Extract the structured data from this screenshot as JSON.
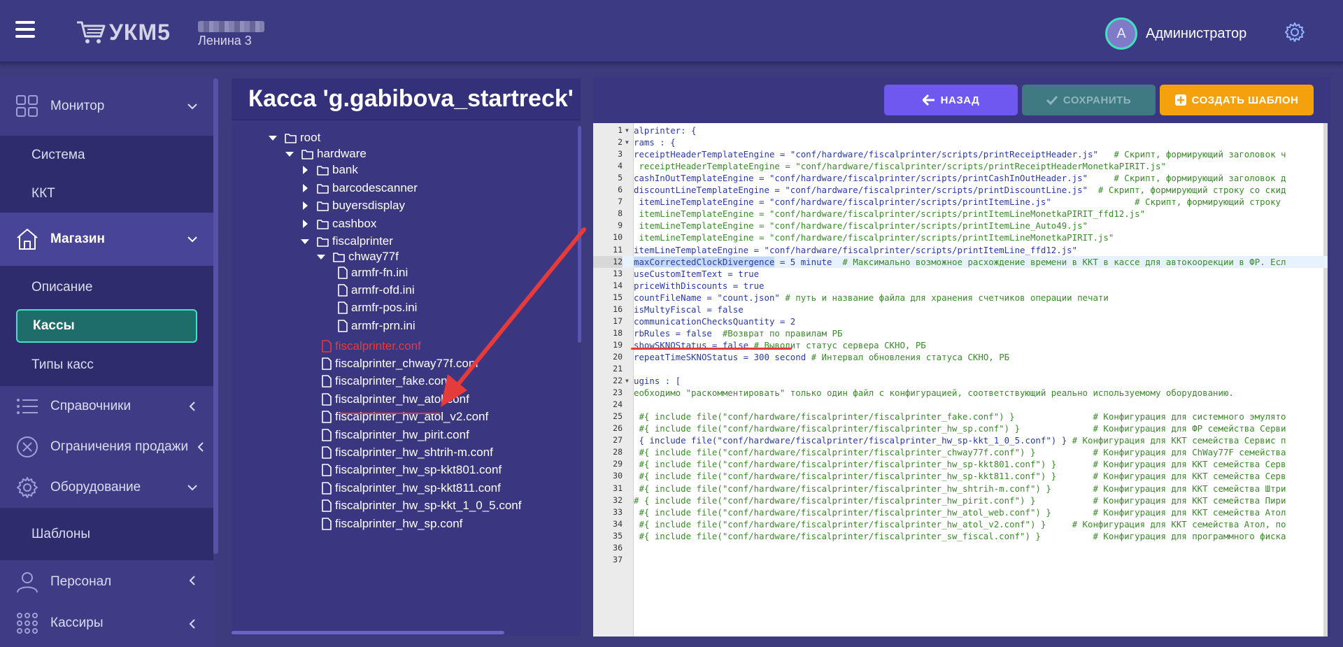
{
  "header": {
    "logo_text": "УКМ5",
    "store_name": "Ленина 3",
    "avatar_letter": "А",
    "user_name": "Администратор"
  },
  "sidebar": {
    "monitor": "Монитор",
    "monitor_items": [
      "Система",
      "ККТ"
    ],
    "shop": "Магазин",
    "shop_items": [
      "Описание",
      "Кассы",
      "Типы касс"
    ],
    "references": "Справочники",
    "restrictions": "Ограничения продажи",
    "equipment": "Оборудование",
    "equipment_items": [
      "Шаблоны"
    ],
    "staff": "Персонал",
    "cashiers": "Кассиры"
  },
  "tree": {
    "title": "Касса 'g.gabibova_startreck'",
    "nodes": [
      "root",
      "hardware",
      "bank",
      "barcodescanner",
      "buyersdisplay",
      "cashbox",
      "fiscalprinter",
      "chway77f",
      "armfr-fn.ini",
      "armfr-ofd.ini",
      "armfr-pos.ini",
      "armfr-prn.ini",
      "fiscalprinter.conf",
      "fiscalprinter_chway77f.conf",
      "fiscalprinter_fake.conf",
      "fiscalprinter_hw_atol.conf",
      "fiscalprinter_hw_atol_v2.conf",
      "fiscalprinter_hw_pirit.conf",
      "fiscalprinter_hw_shtrih-m.conf",
      "fiscalprinter_hw_sp-kkt801.conf",
      "fiscalprinter_hw_sp-kkt811.conf",
      "fiscalprinter_hw_sp-kkt_1_0_5.conf",
      "fiscalprinter_hw_sp.conf"
    ]
  },
  "toolbar": {
    "back_label": "НАЗАД",
    "save_label": "СОХРАНИТЬ",
    "create_label": "СОЗДАТЬ ШАБЛОН"
  },
  "editor": {
    "lines": [
      "alprinter: {",
      "rams : {",
      "receiptHeaderTemplateEngine = \"conf/hardware/fiscalprinter/scripts/printReceiptHeader.js\"   # Скрипт, формирующий заголовок ч",
      " receiptHeaderTemplateEngine = \"conf/hardware/fiscalprinter/scripts/printReceiptHeaderMonetkaPIRIT.js\"",
      "cashInOutTemplateEngine = \"conf/hardware/fiscalprinter/scripts/printCashInOutHeader.js\"     # Скрипт, формирующий заголовок д",
      "discountLineTemplateEngine = \"conf/hardware/fiscalprinter/scripts/printDiscountLine.js\"  # Скрипт, формирующий строку со скид",
      " itemLineTemplateEngine = \"conf/hardware/fiscalprinter/scripts/printItemLine.js\"                # Скрипт, формирующий строку",
      " itemLineTemplateEngine = \"conf/hardware/fiscalprinter/scripts/printItemLineMonetkaPIRIT_ffd12.js\"",
      " itemLineTemplateEngine = \"conf/hardware/fiscalprinter/scripts/printItemLine_Auto49.js\"",
      " itemLineTemplateEngine = \"conf/hardware/fiscalprinter/scripts/printItemLineMonetkaPIRIT.js\"",
      "itemLineTemplateEngine = \"conf/hardware/fiscalprinter/scripts/printItemLine_ffd12.js\"",
      "maxCorrectedClockDivergence = 5 minute  # Максимально возможное расхождение времени в ККТ в кассе для автокоорекции в ФР. Есл",
      "useCustomItemText = true",
      "priceWithDiscounts = true",
      "countFileName = \"count.json\" # путь и название файла для хранения счетчиков операции печати",
      "isMultyFiscal = false",
      "communicationChecksQuantity = 2",
      "rbRules = false  #Возврат по правилам РБ",
      "showSKNOStatus = false # Выводит статус сервера СКНО, РБ",
      "repeatTimeSKNOStatus = 300 second # Интервал обновления статуса СКНО, РБ",
      "",
      "ugins : [",
      "еобходимо \"раскомментировать\" только один файл с конфигурацией, соответствующий реально используемому оборудованию.",
      "",
      " #{ include file(\"conf/hardware/fiscalprinter/fiscalprinter_fake.conf\") }               # Конфигурация для системного эмулято",
      " #{ include file(\"conf/hardware/fiscalprinter/fiscalprinter_hw_sp.conf\") }              # Конфигурация для ФР семейства Серви",
      " { include file(\"conf/hardware/fiscalprinter/fiscalprinter_hw_sp-kkt_1_0_5.conf\") } # Конфигурация для ККТ семейства Сервис п",
      " #{ include file(\"conf/hardware/fiscalprinter/fiscalprinter_chway77f.conf\") }           # Конфигурация для ChWay77F семейства",
      " #{ include file(\"conf/hardware/fiscalprinter/fiscalprinter_hw_sp-kkt801.conf\") }       # Конфигурация для ККТ семейства Серв",
      " #{ include file(\"conf/hardware/fiscalprinter/fiscalprinter_hw_sp-kkt811.conf\") }       # Конфигурация для ККТ семейства Серв",
      " #{ include file(\"conf/hardware/fiscalprinter/fiscalprinter_hw_shtrih-m.conf\") }        # Конфигурация для ККТ семейства Штри",
      "# { include file(\"conf/hardware/fiscalprinter/fiscalprinter_hw_pirit.conf\") }           # Конфигурация для ККТ семейства Пири",
      " #{ include file(\"conf/hardware/fiscalprinter/fiscalprinter_hw_atol_web.conf\") }        # Конфигурация для ККТ семейства Атол",
      " #{ include file(\"conf/hardware/fiscalprinter/fiscalprinter_hw_atol_v2.conf\") }     # Конфигурация для ККТ семейства Атол, по",
      " #{ include file(\"conf/hardware/fiscalprinter/fiscalprinter_sw_fiscal.conf\") }          # Конфигурация для программного фиска",
      "",
      ""
    ]
  },
  "icons": [
    "hamburger-icon",
    "cart-icon",
    "gear-icon",
    "monitor-icon",
    "shop-icon",
    "list-icon",
    "restriction-icon",
    "equipment-icon",
    "person-icon",
    "cashiers-icon",
    "folder-icon",
    "file-icon",
    "arrow-left-icon",
    "check-icon",
    "plus-square-icon"
  ],
  "colors": {
    "accent_teal": "#3ee6b9",
    "back_button": "#6e58ef",
    "save_button": "#3f7a82",
    "create_button": "#f5a10d",
    "annotation_red": "#e53b3b"
  }
}
